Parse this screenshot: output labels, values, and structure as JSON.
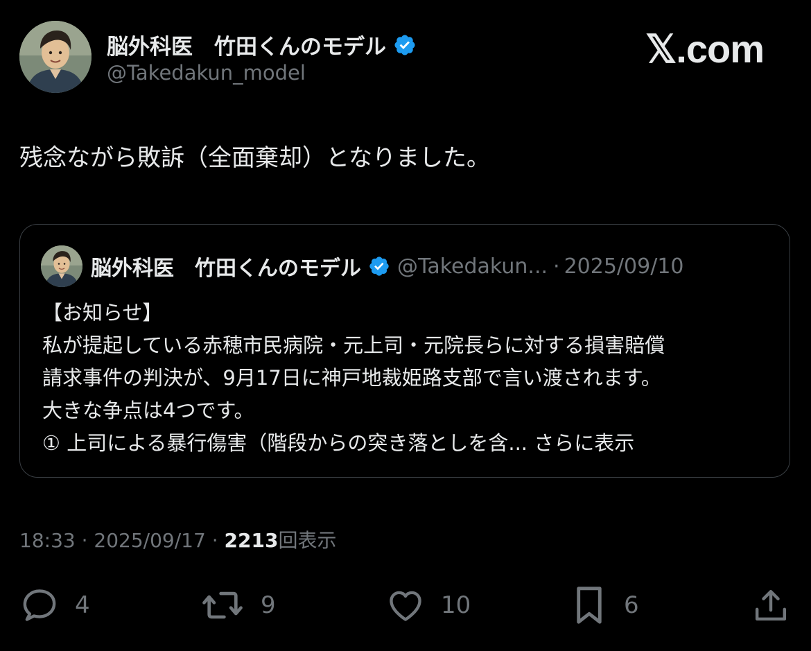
{
  "author": {
    "display_name": "脳外科医　竹田くんのモデル",
    "handle": "@Takedakun_model",
    "verified": true,
    "avatar_icon": "doctor-avatar-illustration"
  },
  "brand": {
    "label": "𝕏.com"
  },
  "tweet": {
    "text": "残念ながら敗訴（全面棄却）となりました。"
  },
  "quoted_tweet": {
    "display_name": "脳外科医　竹田くんのモデル",
    "handle": "@Takedakun...",
    "separator": "·",
    "date": "2025/09/10",
    "lines": [
      "【お知らせ】",
      "私が提起している赤穂市民病院・元上司・元院長らに対する損害賠償",
      "請求事件の判決が、9月17日に神戸地裁姫路支部で言い渡されます。",
      "大きな争点は4つです。",
      "① 上司による暴行傷害（階段からの突き落としを含..."
    ],
    "show_more": "さらに表示"
  },
  "meta": {
    "time": "18:33",
    "sep1": "·",
    "date": "2025/09/17",
    "sep2": "·",
    "views": "2213",
    "views_label": "回表示"
  },
  "actions": {
    "reply_count": "4",
    "repost_count": "9",
    "like_count": "10",
    "bookmark_count": "6"
  },
  "colors": {
    "background": "#000000",
    "primary_text": "#e7e9ea",
    "secondary_text": "#71767b",
    "verified_blue": "#1d9bf0",
    "border": "#3a3f44"
  }
}
